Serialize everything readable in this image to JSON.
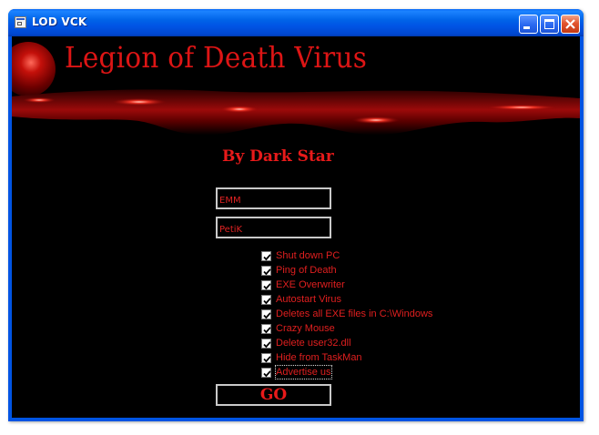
{
  "window": {
    "title": "LOD VCK",
    "controls": {
      "minimize_icon": "minimize-icon",
      "maximize_icon": "maximize-icon",
      "close_icon": "close-icon"
    }
  },
  "banner": {
    "title": "Legion of Death Virus",
    "author": "By Dark Star"
  },
  "inputs": {
    "field1_value": "EMM",
    "field2_value": "PetiK"
  },
  "options": [
    {
      "label": "Shut down PC",
      "checked": true
    },
    {
      "label": "Ping of Death",
      "checked": true
    },
    {
      "label": "EXE Overwriter",
      "checked": true
    },
    {
      "label": "Autostart Virus",
      "checked": true
    },
    {
      "label": "Deletes all EXE files in C:\\Windows",
      "checked": true
    },
    {
      "label": "Crazy Mouse",
      "checked": true
    },
    {
      "label": "Delete user32.dll",
      "checked": true
    },
    {
      "label": "Hide from TaskMan",
      "checked": true
    },
    {
      "label": "Advertise us",
      "checked": true,
      "focused": true
    }
  ],
  "go_button": {
    "label": "GO"
  },
  "colors": {
    "accent_red": "#e01f1f",
    "background": "#000000",
    "titlebar_blue": "#0055e5"
  }
}
